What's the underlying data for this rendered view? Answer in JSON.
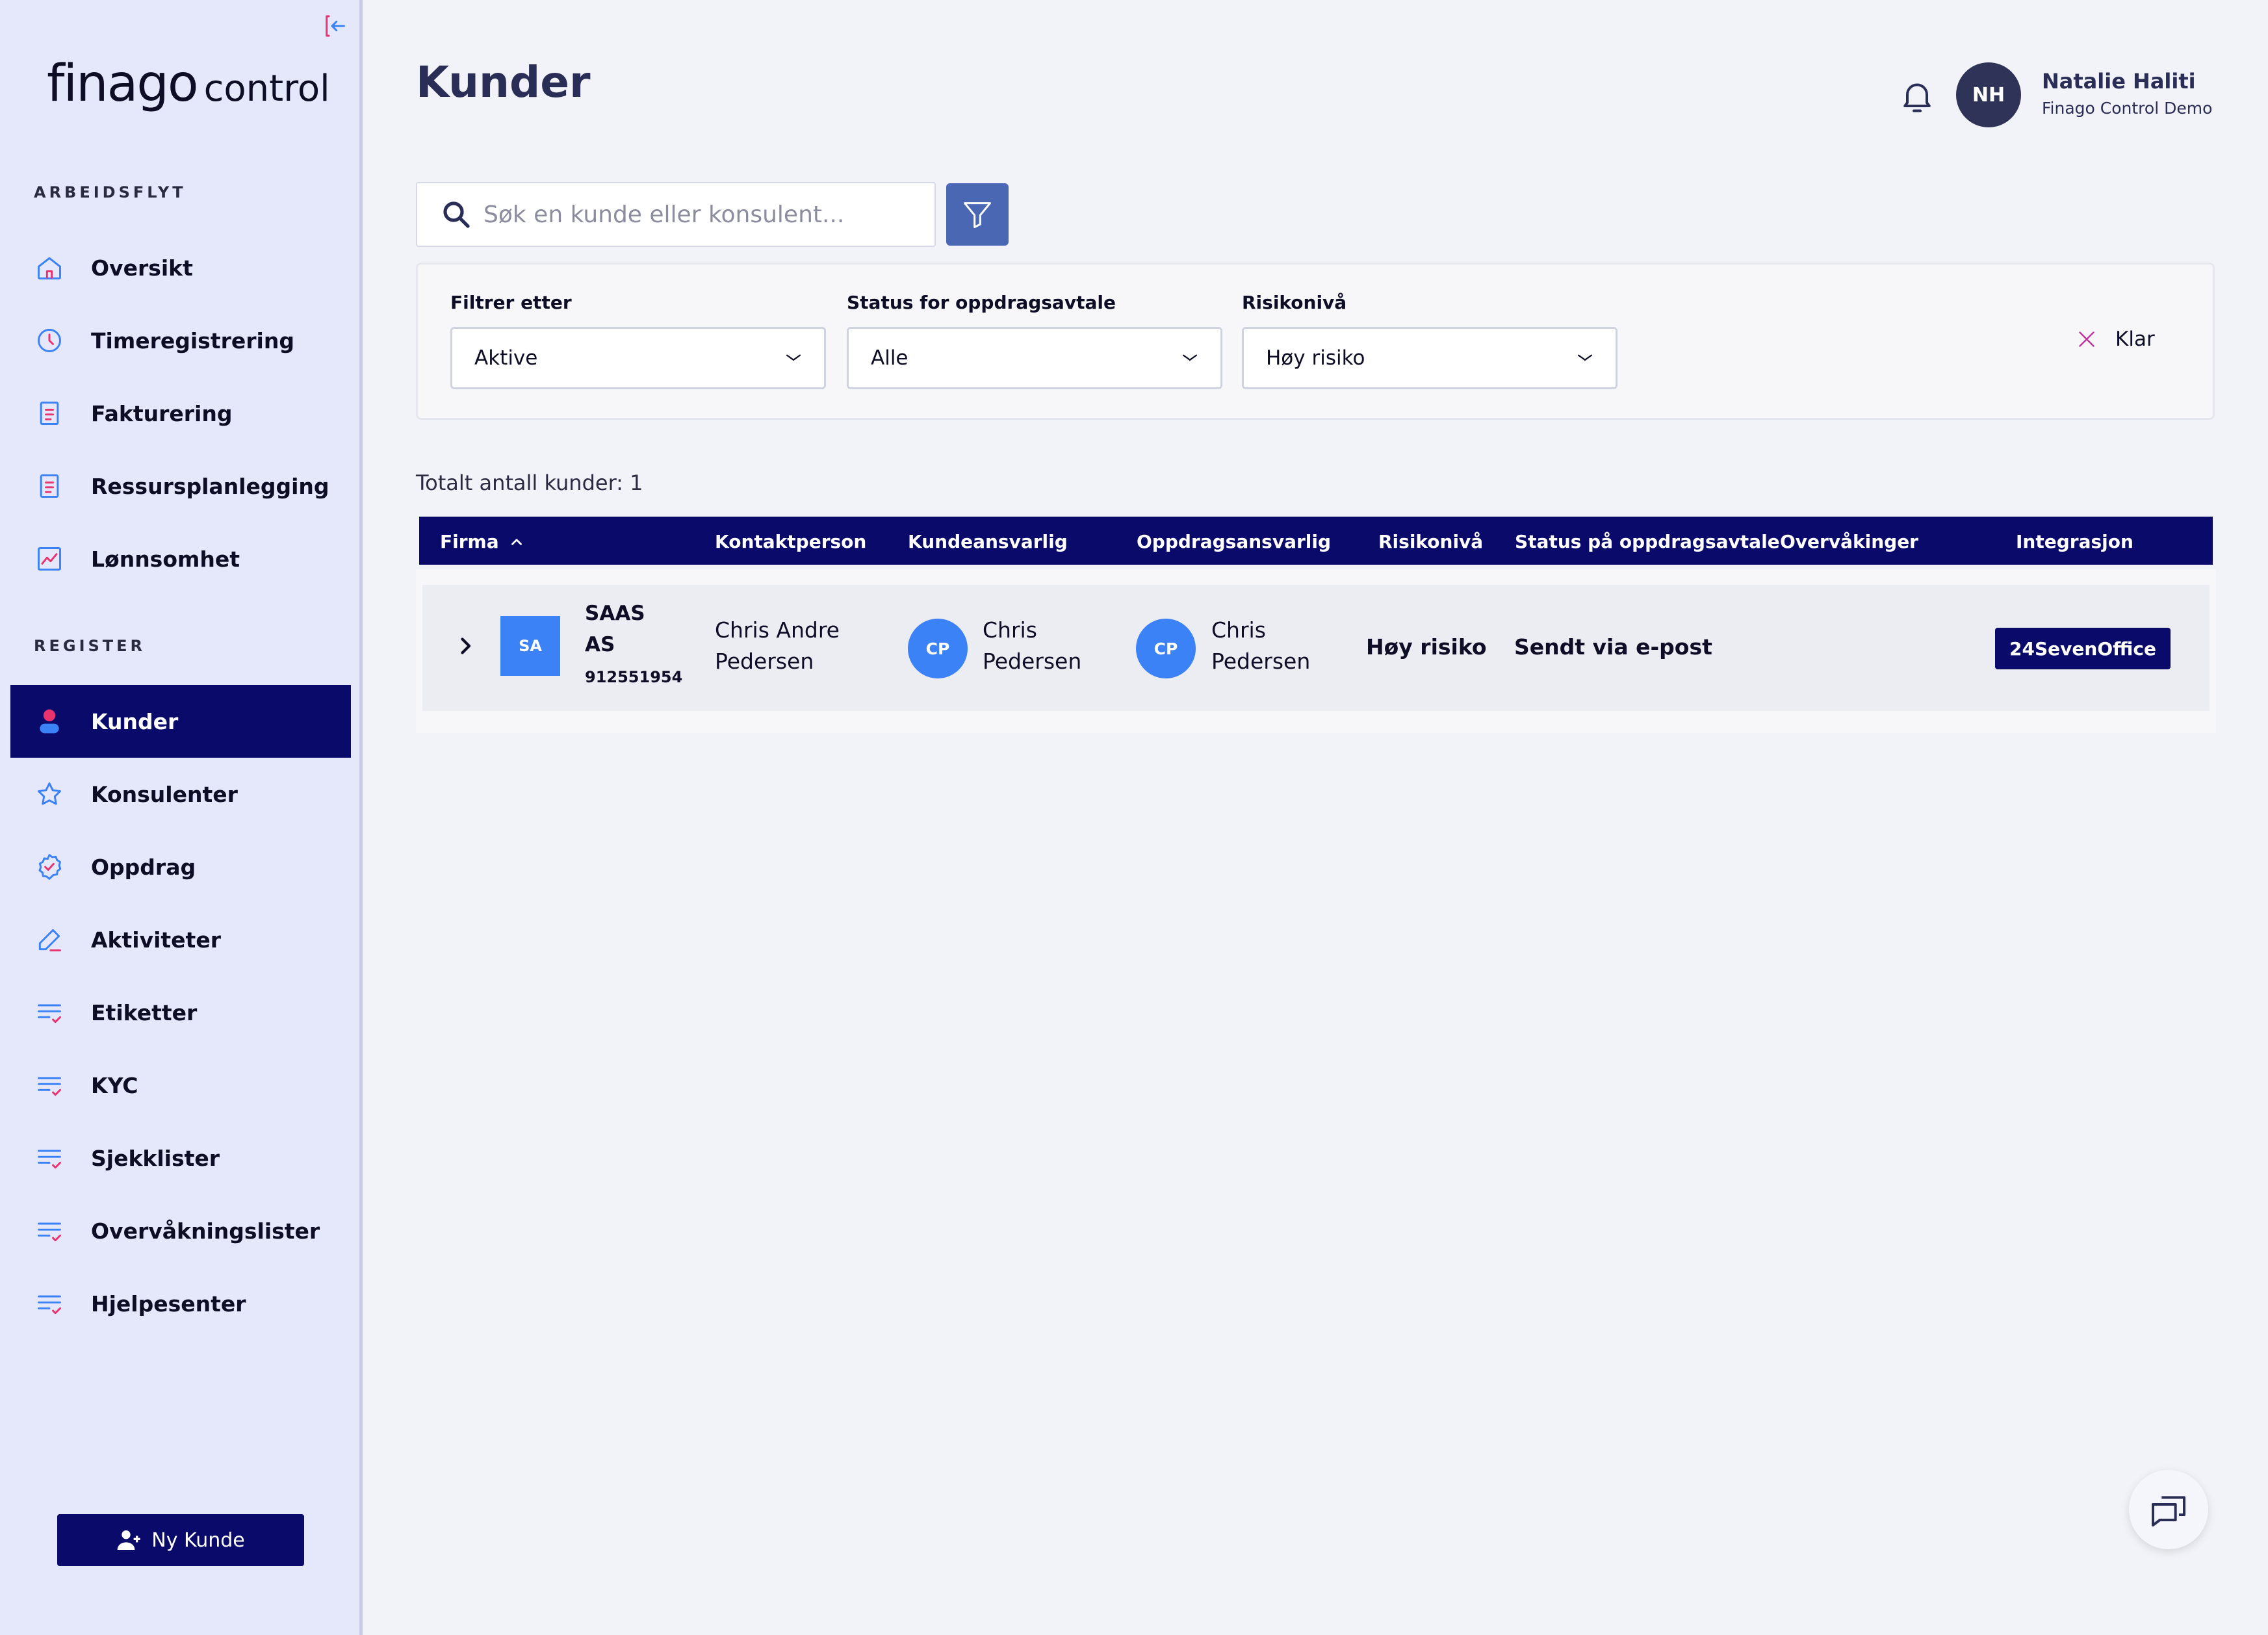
{
  "brand": {
    "name": "finago",
    "product": "control"
  },
  "sidebar": {
    "section_workflow": "ARBEIDSFLYT",
    "section_register": "REGISTER",
    "workflow_items": [
      {
        "label": "Oversikt",
        "icon": "home-icon"
      },
      {
        "label": "Timeregistrering",
        "icon": "clock-icon"
      },
      {
        "label": "Fakturering",
        "icon": "document-icon"
      },
      {
        "label": "Ressursplanlegging",
        "icon": "document-icon"
      },
      {
        "label": "Lønnsomhet",
        "icon": "chart-icon"
      }
    ],
    "register_items": [
      {
        "label": "Kunder",
        "icon": "person-icon",
        "active": true
      },
      {
        "label": "Konsulenter",
        "icon": "star-icon"
      },
      {
        "label": "Oppdrag",
        "icon": "badge-check-icon"
      },
      {
        "label": "Aktiviteter",
        "icon": "pencil-icon"
      },
      {
        "label": "Etiketter",
        "icon": "list-check-icon"
      },
      {
        "label": "KYC",
        "icon": "list-check-icon"
      },
      {
        "label": "Sjekklister",
        "icon": "list-check-icon"
      },
      {
        "label": "Overvåkningslister",
        "icon": "list-check-icon"
      },
      {
        "label": "Hjelpesenter",
        "icon": "list-check-icon"
      }
    ],
    "new_customer_label": "Ny Kunde"
  },
  "header": {
    "title": "Kunder",
    "user": {
      "initials": "NH",
      "name": "Natalie Haliti",
      "org": "Finago Control Demo"
    }
  },
  "search": {
    "placeholder": "Søk en kunde eller konsulent...",
    "value": ""
  },
  "filters": {
    "filter_by": {
      "label": "Filtrer etter",
      "value": "Aktive"
    },
    "agreement_status": {
      "label": "Status for oppdragsavtale",
      "value": "Alle"
    },
    "risk_level": {
      "label": "Risikonivå",
      "value": "Høy risiko"
    },
    "clear_label": "Klar"
  },
  "total_count": "Totalt antall kunder: 1",
  "table": {
    "columns": [
      "Firma",
      "Kontaktperson",
      "Kundeansvarlig",
      "Oppdragsansvarlig",
      "Risikonivå",
      "Status på oppdragsavtale",
      "Overvåkinger",
      "Integrasjon"
    ],
    "rows": [
      {
        "firm_initials": "SA",
        "firm_name_line1": "SAAS",
        "firm_name_line2": "AS",
        "org_number": "912551954",
        "contact_line1": "Chris Andre",
        "contact_line2": "Pedersen",
        "customer_manager_initials": "CP",
        "customer_manager_line1": "Chris",
        "customer_manager_line2": "Pedersen",
        "assignment_manager_initials": "CP",
        "assignment_manager_line1": "Chris",
        "assignment_manager_line2": "Pedersen",
        "risk": "Høy risiko",
        "agreement_status": "Sendt via e-post",
        "monitoring": "",
        "integration": "24SevenOffice"
      }
    ]
  },
  "colors": {
    "navy": "#0a0a6b",
    "sidebar_bg": "#e5e7fb",
    "accent_blue": "#3b82f6",
    "accent_pink": "#e8336f",
    "filter_button": "#4a67b3"
  }
}
